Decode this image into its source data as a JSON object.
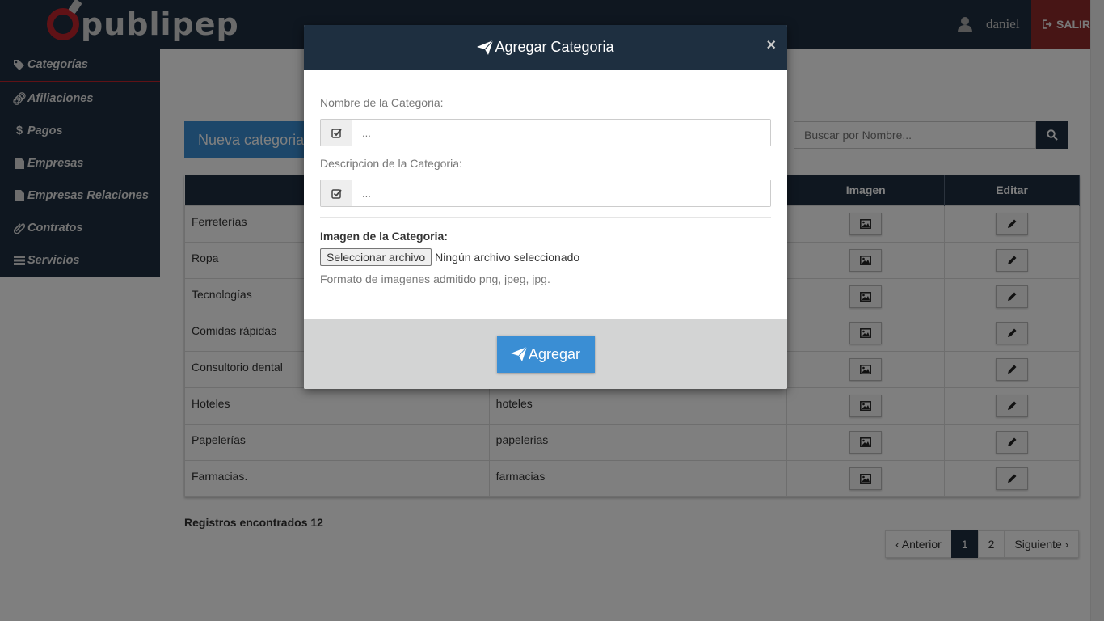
{
  "header": {
    "logo_text": "publipep",
    "user_name": "daniel",
    "logout_label": "SALIR"
  },
  "sidebar": {
    "items": [
      {
        "label": "Categorías",
        "icon": "tags-icon"
      },
      {
        "label": "Afiliaciones",
        "icon": "link-icon"
      },
      {
        "label": "Pagos",
        "icon": "dollar-icon"
      },
      {
        "label": "Empresas",
        "icon": "file-icon"
      },
      {
        "label": "Empresas Relaciones",
        "icon": "file-icon"
      },
      {
        "label": "Contratos",
        "icon": "paperclip-icon"
      },
      {
        "label": "Servicios",
        "icon": "list-icon"
      }
    ]
  },
  "main": {
    "new_button": "Nueva categoria",
    "search_placeholder": "Buscar por Nombre...",
    "table": {
      "headers": [
        "",
        "",
        "Imagen",
        "Editar"
      ],
      "rows": [
        {
          "name": "Ferreterías",
          "desc": ""
        },
        {
          "name": "Ropa",
          "desc": ""
        },
        {
          "name": "Tecnologías",
          "desc": ""
        },
        {
          "name": "Comidas rápidas",
          "desc": ""
        },
        {
          "name": "Consultorio dental",
          "desc": ""
        },
        {
          "name": "Hoteles",
          "desc": "hoteles"
        },
        {
          "name": "Papelerías",
          "desc": "papelerias"
        },
        {
          "name": "Farmacias.",
          "desc": "farmacias"
        }
      ]
    },
    "records_text": "Registros encontrados 12",
    "pager": {
      "prev": "‹ Anterior",
      "pages": [
        "1",
        "2"
      ],
      "next": "Siguiente ›"
    }
  },
  "modal": {
    "title": "Agregar Categoria",
    "close": "×",
    "name_label": "Nombre de la Categoria:",
    "name_placeholder": "...",
    "desc_label": "Descripcion de la Categoria:",
    "desc_placeholder": "...",
    "image_label": "Imagen de la Categoria:",
    "file_button": "Seleccionar archivo",
    "file_status": "Ningún archivo seleccionado",
    "help_text": "Formato de imagenes admitido png, jpeg, jpg.",
    "submit_label": "Agregar"
  },
  "colors": {
    "navy": "#1e2f40",
    "accent_blue": "#3a8ed4",
    "brand_red": "#c0242c"
  }
}
